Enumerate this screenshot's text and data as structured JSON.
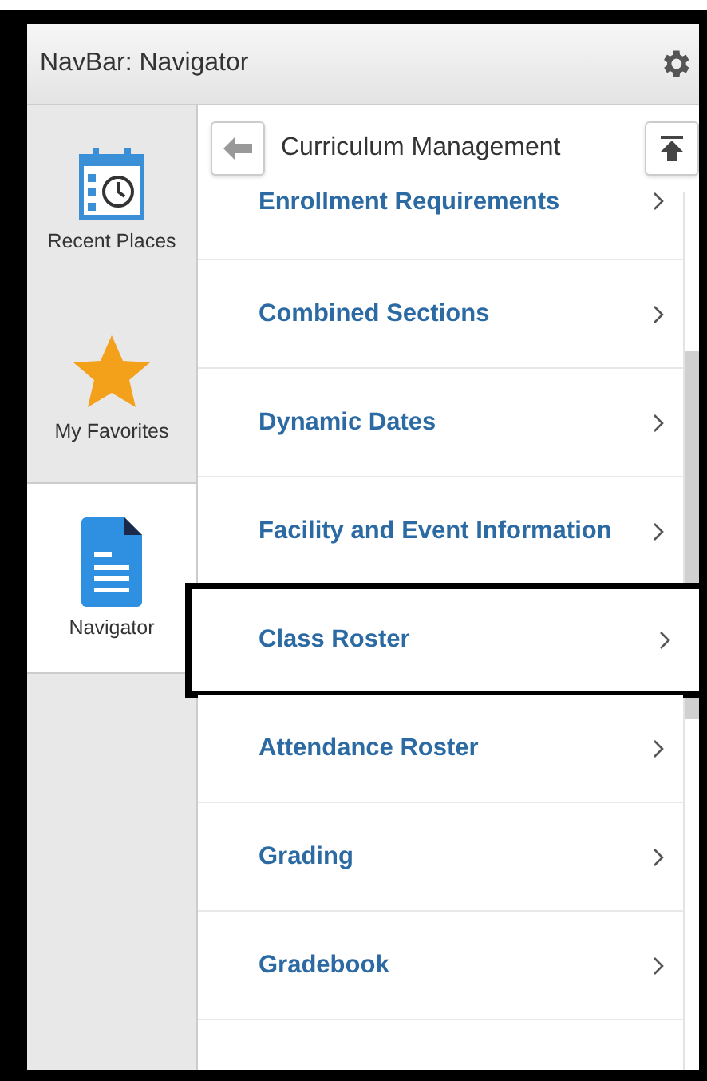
{
  "header": {
    "title": "NavBar: Navigator"
  },
  "sidebar": {
    "items": [
      {
        "label": "Recent Places",
        "kind": "recent",
        "selected": false
      },
      {
        "label": "My Favorites",
        "kind": "favorites",
        "selected": false
      },
      {
        "label": "Navigator",
        "kind": "navigator",
        "selected": true
      }
    ]
  },
  "panel": {
    "title": "Curriculum Management",
    "items": [
      {
        "label": "Enrollment Requirements",
        "annotated": false
      },
      {
        "label": "Combined Sections",
        "annotated": false
      },
      {
        "label": "Dynamic Dates",
        "annotated": false
      },
      {
        "label": "Facility and Event Information",
        "annotated": false
      },
      {
        "label": "Class Roster",
        "annotated": true
      },
      {
        "label": "Attendance Roster",
        "annotated": false
      },
      {
        "label": "Grading",
        "annotated": false
      },
      {
        "label": "Gradebook",
        "annotated": false
      }
    ]
  }
}
